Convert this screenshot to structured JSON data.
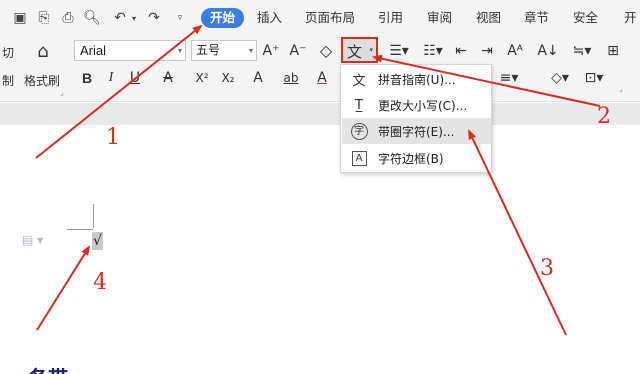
{
  "tabs": {
    "start": "开始",
    "insert": "插入",
    "layout": "页面布局",
    "reference": "引用",
    "review": "审阅",
    "view": "视图",
    "chapter": "章节",
    "security": "安全",
    "more": "开"
  },
  "ribbon": {
    "cut_fragment": "切",
    "format_fragment": "制",
    "format_painter": "格式刷",
    "font_name": "Arial",
    "font_size": "五号",
    "grow_font": "A⁺",
    "shrink_font": "A⁻",
    "clear_format": "◇",
    "bold": "B",
    "italic": "I",
    "underline": "U",
    "strikethrough": "A",
    "superscript": "X²",
    "subscript": "X₂",
    "text_effect": "A",
    "highlight": "ab",
    "font_color": "A",
    "phonetic_glyph": "文"
  },
  "menu": {
    "items": [
      {
        "icon": "文",
        "label": "拼音指南(U)..."
      },
      {
        "icon": "T̲",
        "label": "更改大小写(C)..."
      },
      {
        "icon": "字",
        "label": "带圈字符(E)..."
      },
      {
        "icon": "A",
        "label": "字符边框(B)"
      }
    ]
  },
  "document": {
    "inserted_char": "√",
    "heading": "各带"
  },
  "annotations": [
    "1",
    "2",
    "3",
    "4"
  ],
  "colors": {
    "accent": "#3b7ce8",
    "annotation_red": "#e0281c",
    "heading_blue": "#1a1f8c"
  }
}
